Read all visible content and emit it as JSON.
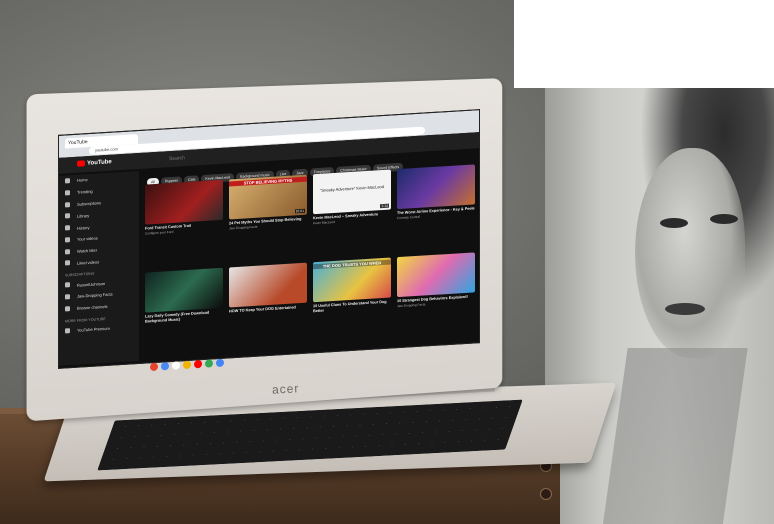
{
  "scene": {
    "description_tags": [
      "laptop",
      "youtube-homepage",
      "wooden-table",
      "portrait-poster"
    ]
  },
  "browser": {
    "tab_title": "YouTube",
    "address": "youtube.com",
    "search_placeholder": "Search"
  },
  "youtube": {
    "logo_text": "YouTube",
    "chips": [
      "All",
      "Puppies",
      "Cats",
      "Kevin MacLeod",
      "Background music",
      "Live",
      "Jazz",
      "Fireplaces",
      "Christmas Music",
      "Sound Effects",
      "Classi…"
    ],
    "sidebar": {
      "items": [
        "Home",
        "Trending",
        "Subscriptions",
        "Library",
        "History",
        "Your videos",
        "Watch later",
        "Liked videos"
      ],
      "subscriptions_head": "SUBSCRIPTIONS",
      "subscriptions": [
        "RussellJohnson",
        "Jaw-Dropping Facts",
        "Browse channels"
      ],
      "more_head": "MORE FROM YOUTUBE",
      "more": [
        "YouTube Premium"
      ]
    },
    "videos": [
      {
        "title": "Ford Transit Custom Trail",
        "meta": "Configure your Ford",
        "duration": "",
        "thumb_text": ""
      },
      {
        "title": "24 Pet Myths You Should Stop Believing",
        "meta": "Jaw-Dropping Facts",
        "duration": "16:01",
        "thumb_text": "STOP BELIEVING MYTHS"
      },
      {
        "title": "Kevin MacLeod ~ Sneaky Adventure",
        "meta": "Kevin MacLeod",
        "duration": "1:14",
        "thumb_text": "\"Sneaky Adventure\" Kevin MacLeod"
      },
      {
        "title": "The Worst Airline Experience - Key & Peele",
        "meta": "Comedy Central",
        "duration": "",
        "thumb_text": ""
      },
      {
        "title": "Lazy Daily Comedy (Free Download Background Music)",
        "meta": "",
        "duration": "",
        "thumb_text": ""
      },
      {
        "title": "HOW TO Keep Your DOG Entertained",
        "meta": "",
        "duration": "",
        "thumb_text": ""
      },
      {
        "title": "10 Useful Clues To Understand Your Dog Better",
        "meta": "",
        "duration": "",
        "thumb_text": "THE DOG TRUSTS YOU WHEN"
      },
      {
        "title": "10 Strangest Dog Behaviors Explained!",
        "meta": "Jaw-Dropping Facts",
        "duration": "",
        "thumb_text": ""
      }
    ]
  },
  "laptop": {
    "brand": "acer"
  }
}
